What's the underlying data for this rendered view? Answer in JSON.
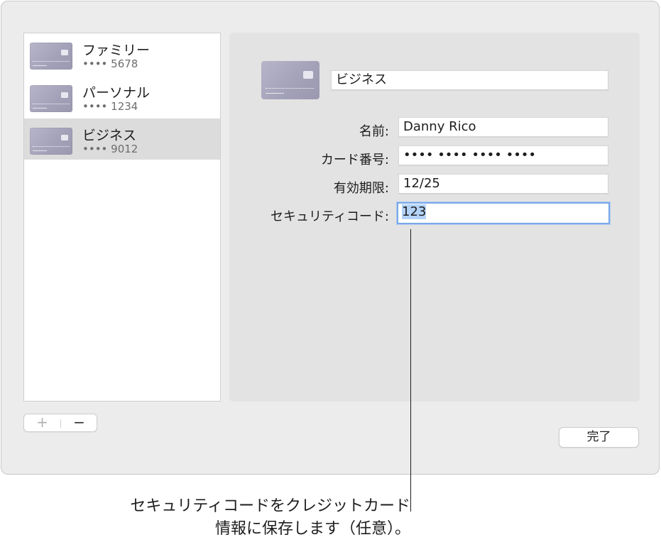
{
  "cards": [
    {
      "name": "ファミリー",
      "masked_number": "•••• 5678",
      "selected": false
    },
    {
      "name": "パーソナル",
      "masked_number": "•••• 1234",
      "selected": false
    },
    {
      "name": "ビジネス",
      "masked_number": "•••• 9012",
      "selected": true
    }
  ],
  "list_controls": {
    "add_label": "+",
    "remove_label": "−"
  },
  "detail": {
    "description_value": "ビジネス",
    "fields": [
      {
        "label": "名前:",
        "value": "Danny Rico"
      },
      {
        "label": "カード番号:",
        "value": "•••• •••• •••• ••••"
      },
      {
        "label": "有効期限:",
        "value": "12/25"
      },
      {
        "label": "セキュリティコード:",
        "value": "123"
      }
    ]
  },
  "done_label": "完了",
  "callout": {
    "line1": "セキュリティコードをクレジットカード",
    "line2": "情報に保存します（任意）。"
  },
  "colors": {
    "window_bg": "#ececec",
    "detail_bg": "#e3e3e3",
    "selection_bg": "#dcdcdc",
    "focus_ring": "#7aa8e8",
    "text_selection": "#b3d3f7",
    "card_gradient": "#a3a1b8"
  }
}
